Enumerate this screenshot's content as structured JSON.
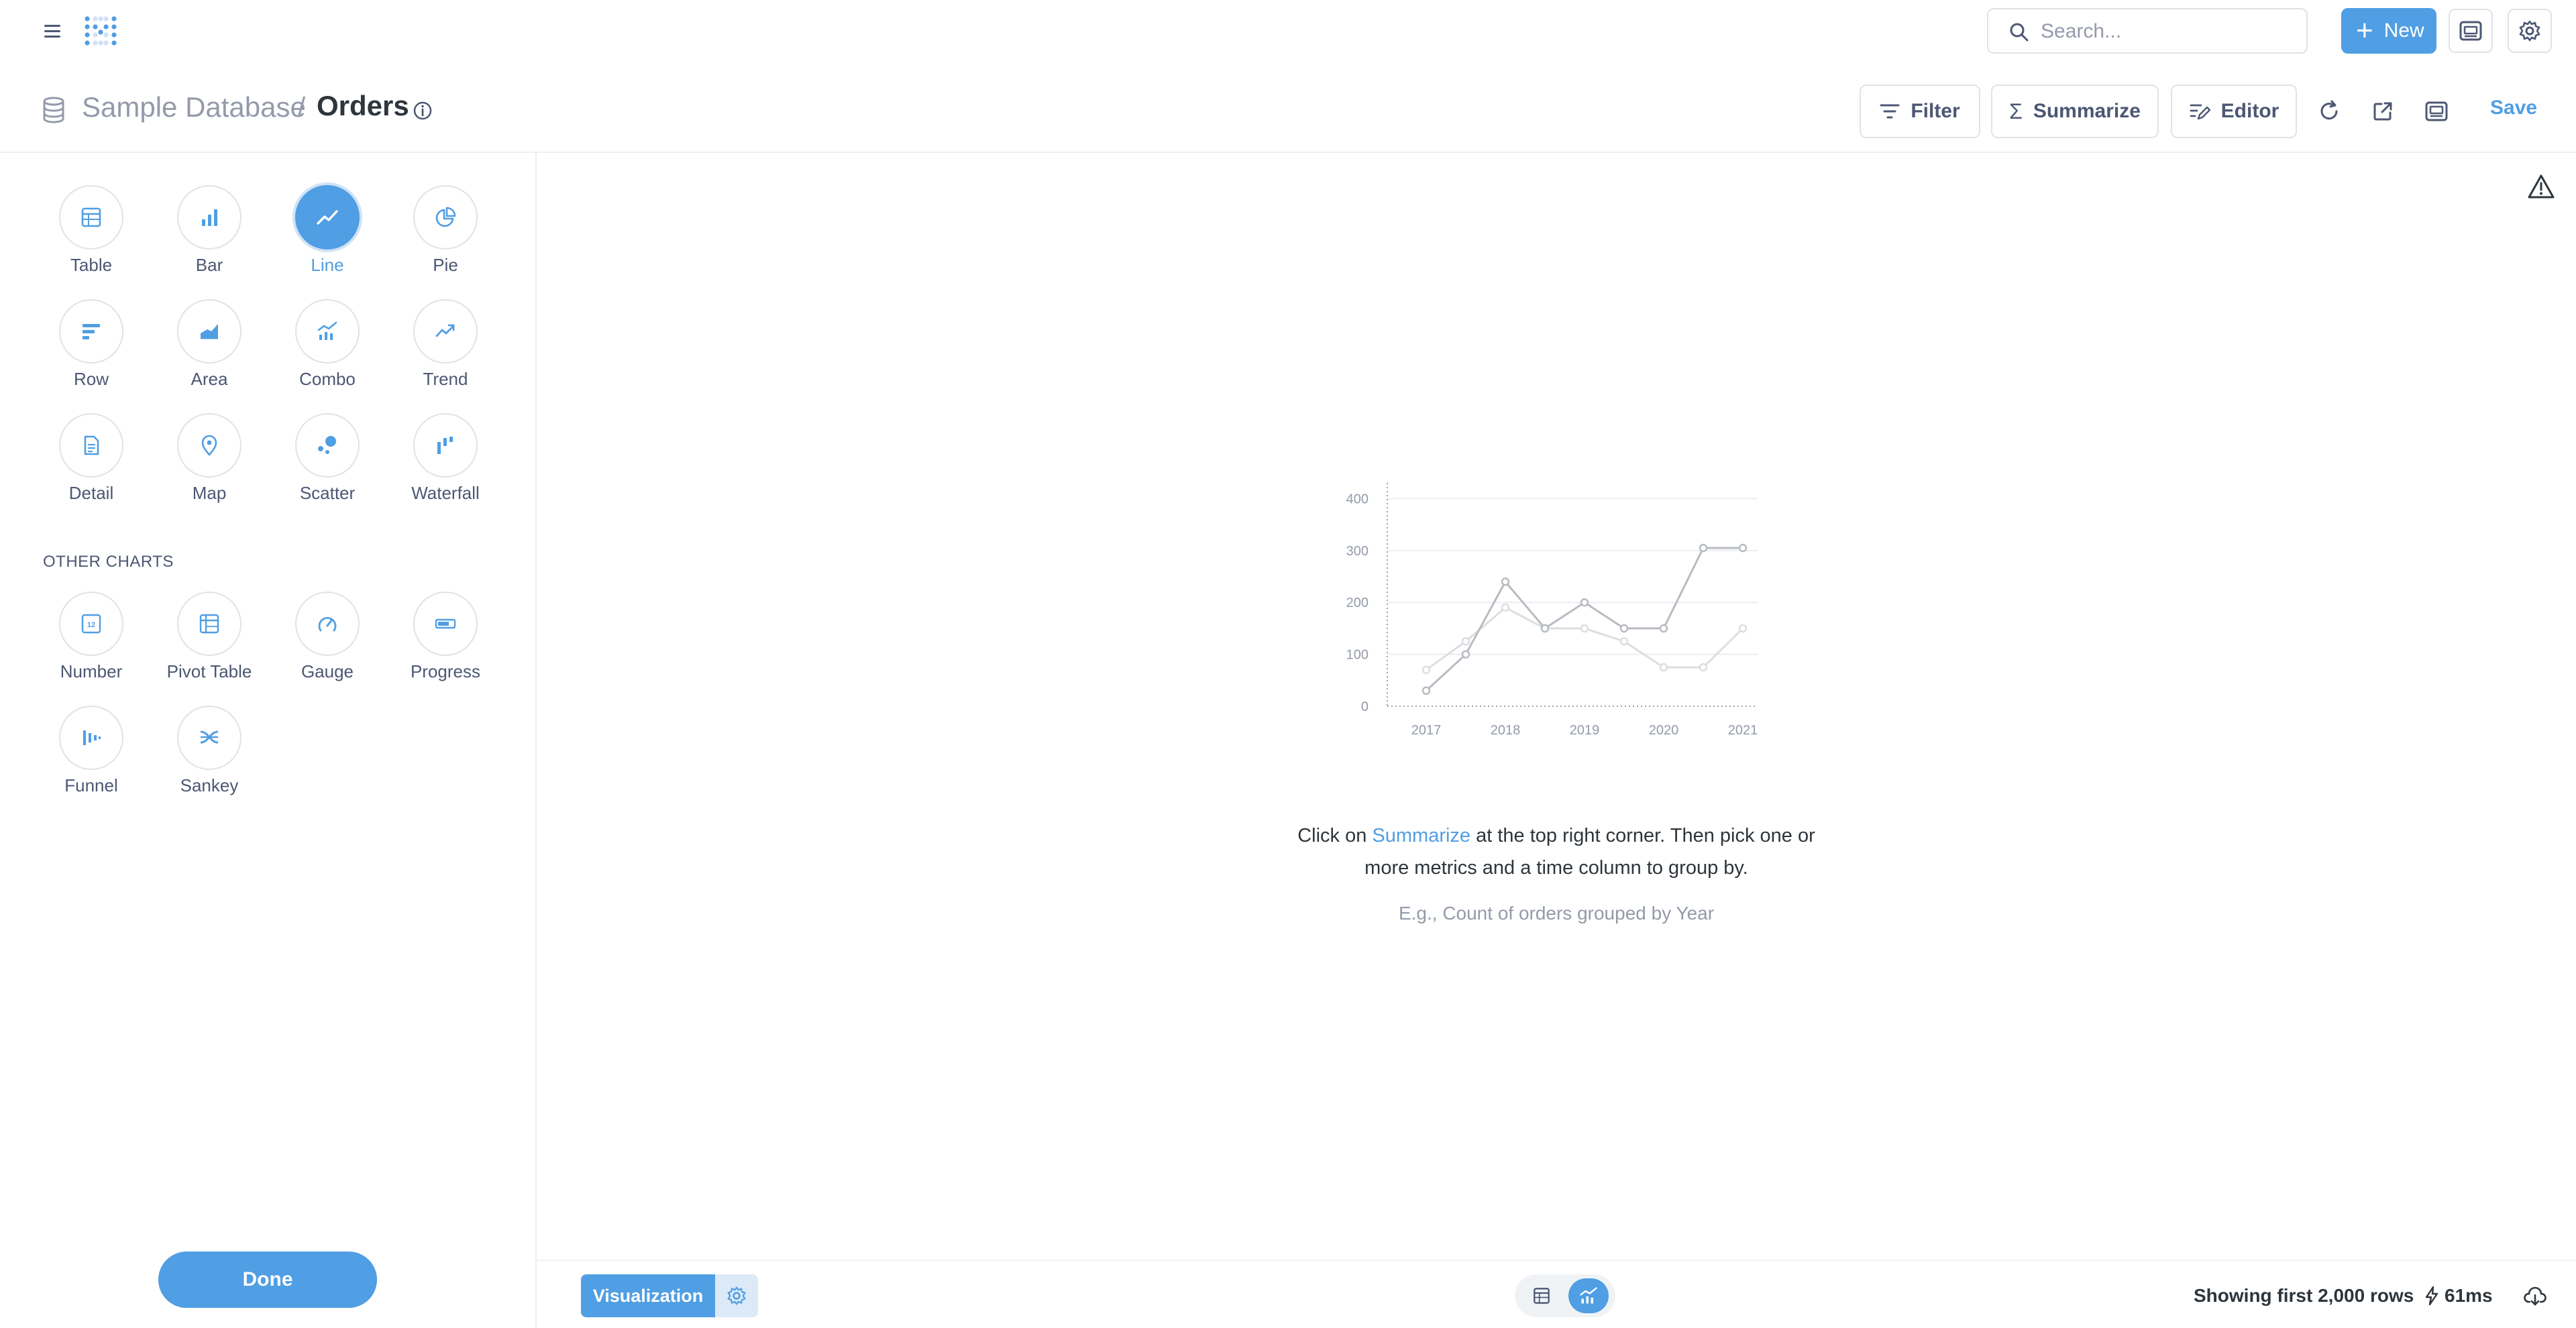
{
  "colors": {
    "brand": "#509ee3",
    "text_dark": "#2e353b",
    "text_medium": "#4c5773",
    "text_light": "#949aab",
    "border": "#dfe3e8"
  },
  "topnav": {
    "search_placeholder": "Search...",
    "new_label": "New",
    "icons": [
      "menu-icon",
      "metabase-logo",
      "search-icon",
      "plus-icon",
      "embed-icon",
      "gear-icon"
    ]
  },
  "header": {
    "database": "Sample Database",
    "separator": "/",
    "title": "Orders",
    "filter_label": "Filter",
    "summarize_label": "Summarize",
    "editor_label": "Editor",
    "save_label": "Save",
    "icons": [
      "database-icon",
      "info-icon",
      "filter-icon",
      "sigma-icon",
      "notebook-icon",
      "refresh-icon",
      "external-link-icon",
      "embed-icon"
    ]
  },
  "sidebar": {
    "charts": [
      {
        "label": "Table",
        "icon": "table-icon",
        "selected": false
      },
      {
        "label": "Bar",
        "icon": "bar-chart-icon",
        "selected": false
      },
      {
        "label": "Line",
        "icon": "line-chart-icon",
        "selected": true
      },
      {
        "label": "Pie",
        "icon": "pie-chart-icon",
        "selected": false
      },
      {
        "label": "Row",
        "icon": "row-chart-icon",
        "selected": false
      },
      {
        "label": "Area",
        "icon": "area-chart-icon",
        "selected": false
      },
      {
        "label": "Combo",
        "icon": "combo-chart-icon",
        "selected": false
      },
      {
        "label": "Trend",
        "icon": "trend-icon",
        "selected": false
      },
      {
        "label": "Detail",
        "icon": "detail-icon",
        "selected": false
      },
      {
        "label": "Map",
        "icon": "map-pin-icon",
        "selected": false
      },
      {
        "label": "Scatter",
        "icon": "scatter-icon",
        "selected": false
      },
      {
        "label": "Waterfall",
        "icon": "waterfall-icon",
        "selected": false
      }
    ],
    "other_heading": "OTHER CHARTS",
    "other_charts": [
      {
        "label": "Number",
        "icon": "number-icon",
        "badge": "12"
      },
      {
        "label": "Pivot Table",
        "icon": "pivot-table-icon"
      },
      {
        "label": "Gauge",
        "icon": "gauge-icon"
      },
      {
        "label": "Progress",
        "icon": "progress-icon"
      },
      {
        "label": "Funnel",
        "icon": "funnel-icon"
      },
      {
        "label": "Sankey",
        "icon": "sankey-icon"
      }
    ],
    "done_label": "Done"
  },
  "main": {
    "warning_icon": "warning-icon",
    "hint_before": "Click on ",
    "hint_link": "Summarize",
    "hint_after": " at the top right corner. Then pick one or more metrics and a time column to group by.",
    "example": "E.g., Count of orders grouped by Year"
  },
  "chart_data": {
    "type": "line",
    "x": [
      "2017",
      "2017.5",
      "2018",
      "2018.5",
      "2019",
      "2019.5",
      "2020",
      "2020.5",
      "2021"
    ],
    "x_tick_labels": [
      "2017",
      "2018",
      "2019",
      "2020",
      "2021"
    ],
    "y_tick_labels": [
      "0",
      "100",
      "200",
      "300",
      "400"
    ],
    "ylim": [
      0,
      420
    ],
    "series": [
      {
        "values": [
          30,
          100,
          240,
          150,
          200,
          150,
          150,
          305,
          305
        ],
        "color": "#b8bbc1"
      },
      {
        "values": [
          70,
          125,
          190,
          150,
          150,
          125,
          75,
          75,
          150
        ],
        "color": "#dcdee1"
      }
    ],
    "grid": true
  },
  "footer": {
    "visualization_label": "Visualization",
    "rows_label": "Showing first 2,000 rows",
    "timing": "61ms",
    "icons": [
      "gear-icon",
      "table-view-icon",
      "chart-view-icon",
      "bolt-icon",
      "download-icon"
    ]
  }
}
